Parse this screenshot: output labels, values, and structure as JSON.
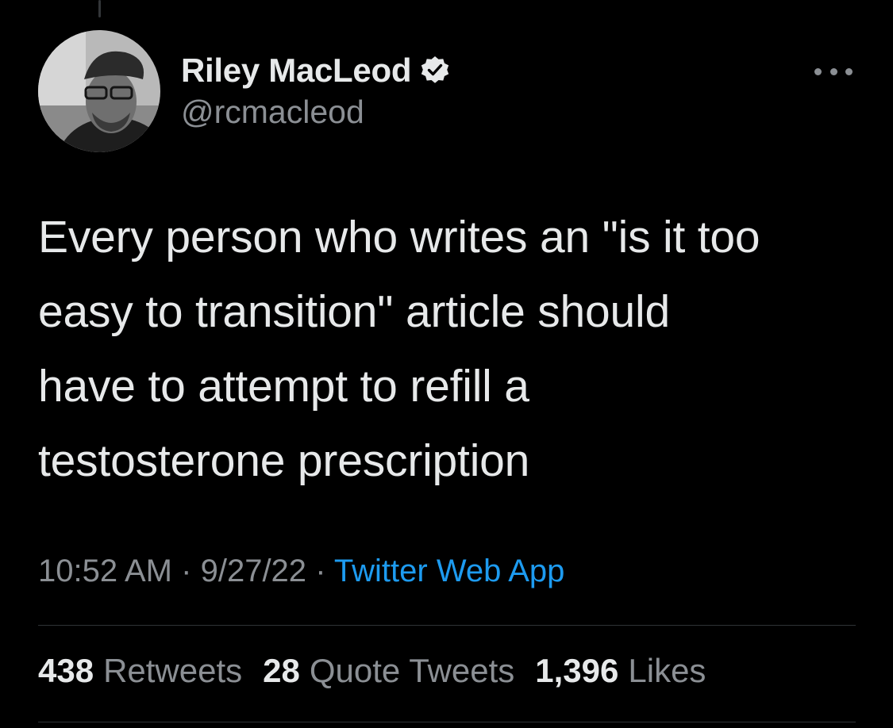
{
  "author": {
    "display_name": "Riley MacLeod",
    "handle": "@rcmacleod",
    "verified": true
  },
  "tweet": {
    "text": "Every person who writes an \"is it too\neasy to transition\" article should\nhave to attempt to refill a\ntestosterone prescription"
  },
  "meta": {
    "time": "10:52 AM",
    "separator": "·",
    "date": "9/27/22",
    "source": "Twitter Web App"
  },
  "stats": {
    "retweets": {
      "count": "438",
      "label": "Retweets"
    },
    "quote_tweets": {
      "count": "28",
      "label": "Quote Tweets"
    },
    "likes": {
      "count": "1,396",
      "label": "Likes"
    }
  },
  "icons": {
    "verified": "verified-badge-icon",
    "more": "more-options-icon"
  },
  "colors": {
    "background": "#000000",
    "primary_text": "#e7e9ea",
    "secondary_text": "#8b8f94",
    "link": "#1d9bf0",
    "divider": "#2f3336"
  }
}
